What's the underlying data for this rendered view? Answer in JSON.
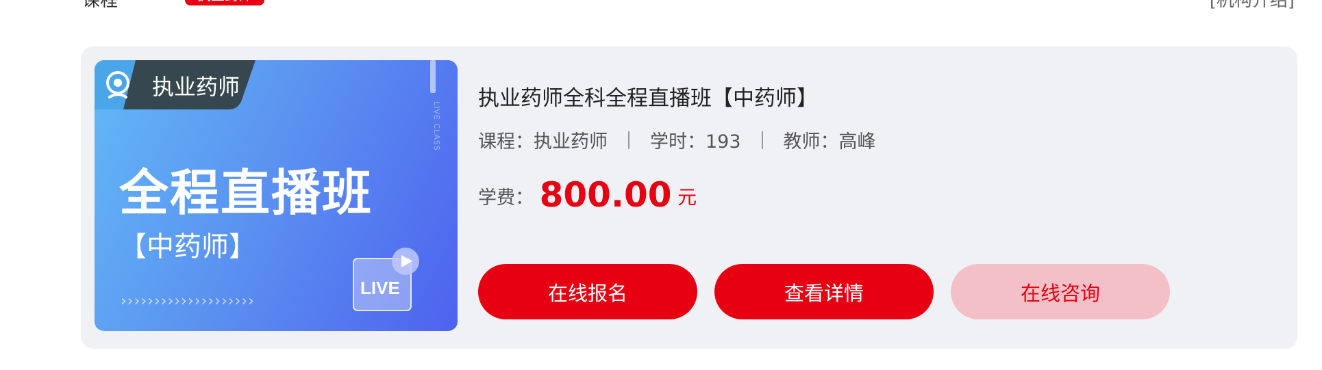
{
  "top": {
    "left_text": "课程",
    "badge": "执业药师",
    "right_text": "[机构介绍]"
  },
  "thumbnail": {
    "tag": "执业药师",
    "title": "全程直播班",
    "subtitle": "【中药师】",
    "side_text": "LIVE CLASS",
    "arrows": "››››››››››››››››››››",
    "live_label": "LIVE"
  },
  "course": {
    "title": "执业药师全科全程直播班【中药师】",
    "meta": {
      "course": "课程：执业药师",
      "hours": "学时：193",
      "teacher": "教师：高峰"
    },
    "fee_label": "学费：",
    "fee_amount": "800.00",
    "fee_unit": "元"
  },
  "buttons": {
    "enroll": "在线报名",
    "details": "查看详情",
    "consult": "在线咨询"
  },
  "colors": {
    "accent": "#e60012",
    "card_bg": "#f0f1f5",
    "consult_bg": "#f2c0c6"
  }
}
